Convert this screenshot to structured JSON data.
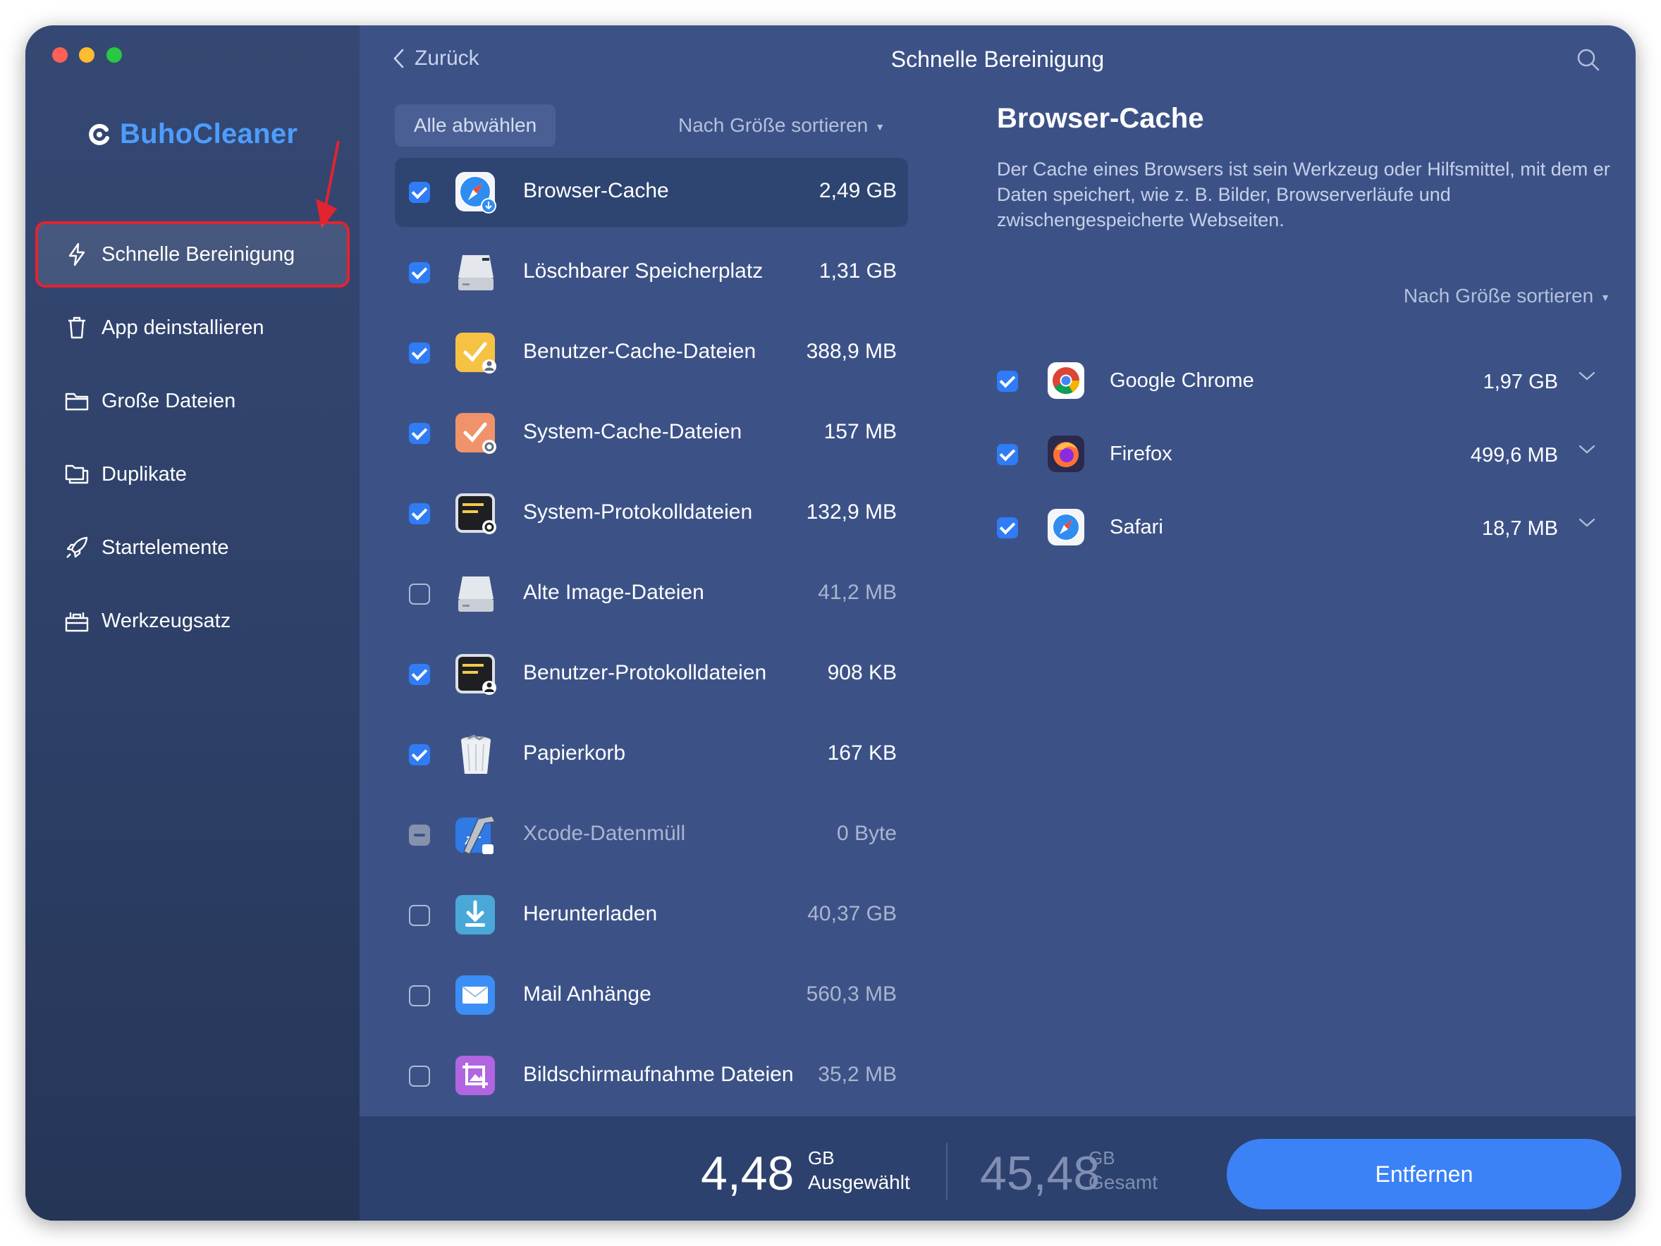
{
  "app": {
    "name": "BuhoCleaner",
    "brand_color": "#4d9dff",
    "accent_color": "#3b82f6",
    "highlight_color": "#e32330"
  },
  "sidebar": {
    "items": [
      {
        "label": "Schnelle Bereinigung",
        "icon": "lightning-icon",
        "active": true
      },
      {
        "label": "App deinstallieren",
        "icon": "trash-icon",
        "active": false
      },
      {
        "label": "Große Dateien",
        "icon": "folder-icon",
        "active": false
      },
      {
        "label": "Duplikate",
        "icon": "duplicate-folders-icon",
        "active": false
      },
      {
        "label": "Startelemente",
        "icon": "rocket-icon",
        "active": false
      },
      {
        "label": "Werkzeugsatz",
        "icon": "toolbox-icon",
        "active": false
      }
    ]
  },
  "header": {
    "back_label": "Zurück",
    "title": "Schnelle Bereinigung"
  },
  "list_toolbar": {
    "deselect_label": "Alle abwählen",
    "sort_label": "Nach Größe sortieren"
  },
  "items": [
    {
      "name": "Browser-Cache",
      "size": "2,49 GB",
      "state": "checked",
      "icon": "safari-download-icon"
    },
    {
      "name": "Löschbarer Speicherplatz",
      "size": "1,31 GB",
      "state": "checked",
      "icon": "hard-drive-icon"
    },
    {
      "name": "Benutzer-Cache-Dateien",
      "size": "388,9 MB",
      "state": "checked",
      "icon": "user-cache-icon"
    },
    {
      "name": "System-Cache-Dateien",
      "size": "157 MB",
      "state": "checked",
      "icon": "system-cache-icon"
    },
    {
      "name": "System-Protokolldateien",
      "size": "132,9 MB",
      "state": "checked",
      "icon": "system-log-icon"
    },
    {
      "name": "Alte Image-Dateien",
      "size": "41,2 MB",
      "state": "unchecked",
      "icon": "disk-image-icon"
    },
    {
      "name": "Benutzer-Protokolldateien",
      "size": "908 KB",
      "state": "checked",
      "icon": "user-log-icon"
    },
    {
      "name": "Papierkorb",
      "size": "167 KB",
      "state": "checked",
      "icon": "trash-bin-icon"
    },
    {
      "name": "Xcode-Datenmüll",
      "size": "0 Byte",
      "state": "partial",
      "icon": "xcode-icon"
    },
    {
      "name": "Herunterladen",
      "size": "40,37 GB",
      "state": "unchecked",
      "icon": "downloads-icon"
    },
    {
      "name": "Mail Anhänge",
      "size": "560,3 MB",
      "state": "unchecked",
      "icon": "mail-icon"
    },
    {
      "name": "Bildschirmaufnahme Dateien",
      "size": "35,2 MB",
      "state": "unchecked",
      "icon": "screenshot-icon"
    }
  ],
  "detail": {
    "title": "Browser-Cache",
    "description": "Der Cache eines Browsers ist sein Werkzeug oder Hilfsmittel, mit dem er Daten speichert, wie z. B. Bilder, Browserverläufe und zwischengespeicherte Webseiten.",
    "sort_label": "Nach Größe sortieren",
    "browsers": [
      {
        "name": "Google Chrome",
        "size": "1,97 GB",
        "state": "checked",
        "icon": "chrome-icon"
      },
      {
        "name": "Firefox",
        "size": "499,6 MB",
        "state": "checked",
        "icon": "firefox-icon"
      },
      {
        "name": "Safari",
        "size": "18,7 MB",
        "state": "checked",
        "icon": "safari-icon"
      }
    ]
  },
  "footer": {
    "selected_value": "4,48",
    "selected_unit": "GB",
    "selected_label": "Ausgewählt",
    "total_value": "45,48",
    "total_unit": "GB",
    "total_label": "Gesamt",
    "remove_label": "Entfernen"
  }
}
